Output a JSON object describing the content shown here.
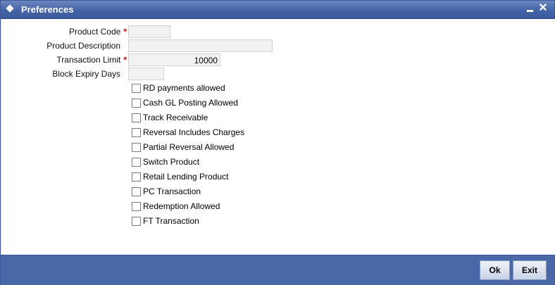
{
  "window": {
    "title": "Preferences"
  },
  "form": {
    "product_code": {
      "label": "Product Code",
      "value": ""
    },
    "product_description": {
      "label": "Product Description",
      "value": ""
    },
    "transaction_limit": {
      "label": "Transaction Limit",
      "value": "10000"
    },
    "block_expiry_days": {
      "label": "Block Expiry Days",
      "value": ""
    },
    "required_marker": "*"
  },
  "checkboxes": [
    {
      "label": "RD payments allowed",
      "checked": false
    },
    {
      "label": "Cash GL Posting Allowed",
      "checked": false
    },
    {
      "label": "Track Receivable",
      "checked": false
    },
    {
      "label": "Reversal Includes Charges",
      "checked": false
    },
    {
      "label": "Partial Reversal Allowed",
      "checked": false
    },
    {
      "label": "Switch Product",
      "checked": false
    },
    {
      "label": "Retail Lending Product",
      "checked": false
    },
    {
      "label": "PC Transaction",
      "checked": false
    },
    {
      "label": "Redemption Allowed",
      "checked": false
    },
    {
      "label": "FT Transaction",
      "checked": false
    }
  ],
  "footer": {
    "ok_label": "Ok",
    "exit_label": "Exit"
  },
  "colors": {
    "titlebar": "#4464a8",
    "footer": "#4a67a8",
    "required": "#cc0000"
  }
}
